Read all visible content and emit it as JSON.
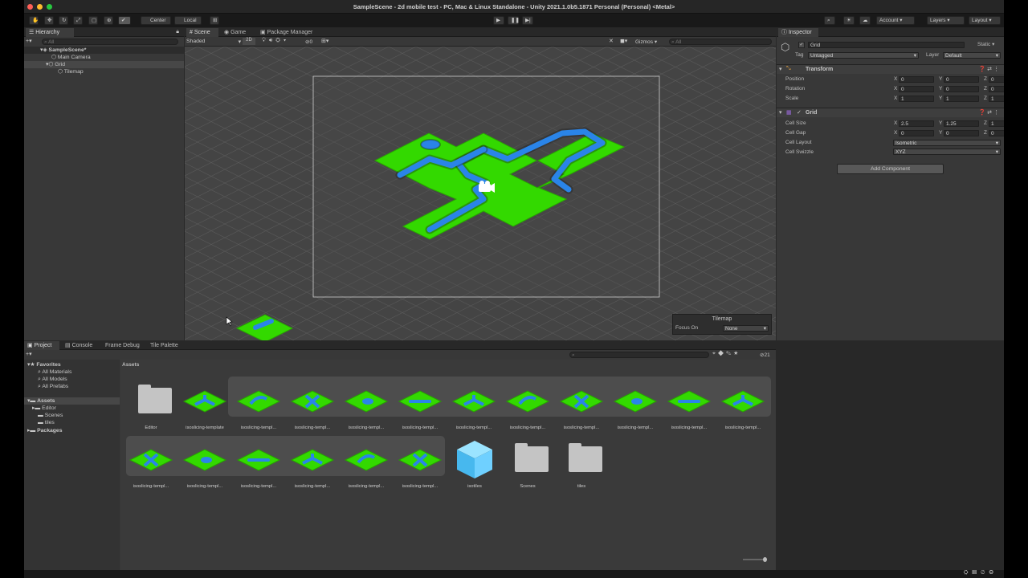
{
  "window": {
    "title": "SampleScene - 2d mobile test - PC, Mac & Linux Standalone - Unity 2021.1.0b5.1871 Personal (Personal) <Metal>"
  },
  "toolbar": {
    "center": "Center",
    "local": "Local",
    "account": "Account",
    "layers": "Layers",
    "layout": "Layout"
  },
  "hierarchy": {
    "tab": "Hierarchy",
    "search_placeholder": "All",
    "scene": "SampleScene*",
    "items": [
      "Main Camera",
      "Grid",
      "Tilemap"
    ]
  },
  "scene": {
    "tabs": [
      "Scene",
      "Game",
      "Package Manager"
    ],
    "shading": "Shaded",
    "mode2d": "2D",
    "gizmos": "Gizmos",
    "search_placeholder": "All",
    "overlay_title": "Tilemap",
    "focus_label": "Focus On",
    "focus_value": "None",
    "zero": "0"
  },
  "inspector": {
    "tab": "Inspector",
    "object_name": "Grid",
    "static_label": "Static",
    "tag_label": "Tag",
    "tag_value": "Untagged",
    "layer_label": "Layer",
    "layer_value": "Default",
    "transform": {
      "title": "Transform",
      "rows": [
        {
          "label": "Position",
          "x": "0",
          "y": "0",
          "z": "0"
        },
        {
          "label": "Rotation",
          "x": "0",
          "y": "0",
          "z": "0"
        },
        {
          "label": "Scale",
          "x": "1",
          "y": "1",
          "z": "1"
        }
      ]
    },
    "grid": {
      "title": "Grid",
      "cell_size": {
        "label": "Cell Size",
        "x": "2.5",
        "y": "1.25",
        "z": "1"
      },
      "cell_gap": {
        "label": "Cell Gap",
        "x": "0",
        "y": "0",
        "z": "0"
      },
      "cell_layout": {
        "label": "Cell Layout",
        "value": "Isometric"
      },
      "cell_swizzle": {
        "label": "Cell Swizzle",
        "value": "XYZ"
      }
    },
    "axis": {
      "x": "X",
      "y": "Y",
      "z": "Z"
    },
    "add_component": "Add Component"
  },
  "bottom": {
    "tabs": [
      "Project",
      "Console",
      "Frame Debug",
      "Tile Palette"
    ],
    "count": "21",
    "sidebar": {
      "favorites": "Favorites",
      "favorite_items": [
        "All Materials",
        "All Models",
        "All Prefabs"
      ],
      "assets": "Assets",
      "asset_items": [
        "Editor",
        "Scenes",
        "tiles"
      ],
      "packages": "Packages"
    },
    "breadcrumb": "Assets",
    "assets_row1": [
      "Editor",
      "isoslicing-template",
      "isoslicing-templ...",
      "isoslicing-templ...",
      "isoslicing-templ...",
      "isoslicing-templ...",
      "isoslicing-templ...",
      "isoslicing-templ...",
      "isoslicing-templ...",
      "isoslicing-templ...",
      "isoslicing-templ...",
      "isoslicing-templ..."
    ],
    "assets_row2": [
      "isoslicing-templ...",
      "isoslicing-templ...",
      "isoslicing-templ...",
      "isoslicing-templ...",
      "isoslicing-templ...",
      "isoslicing-templ...",
      "isotiles",
      "Scenes",
      "tiles"
    ]
  },
  "colors": {
    "grass": "#33d900",
    "water": "#2a84e8",
    "bg": "#282828",
    "panel": "#383838",
    "accent": "#2c5d87"
  }
}
